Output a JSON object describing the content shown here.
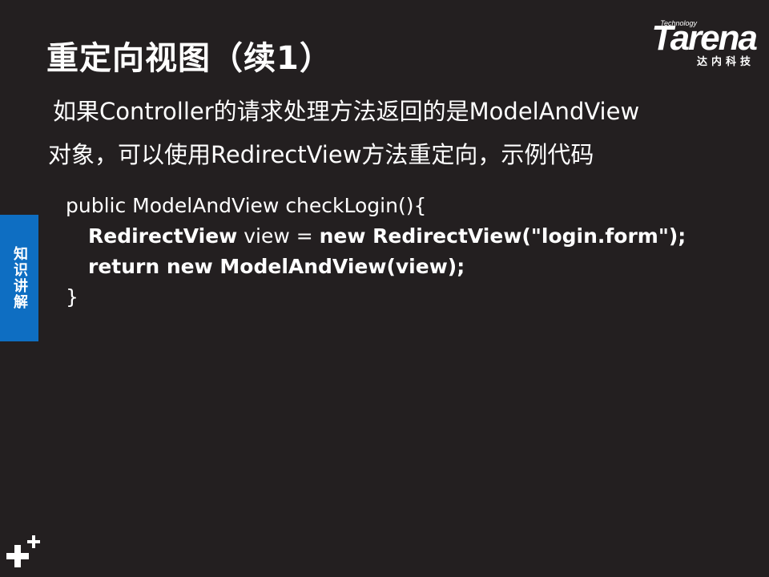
{
  "slide": {
    "title": "重定向视图（续1）",
    "intro_line1": "如果Controller的请求处理方法返回的是ModelAndView",
    "intro_line2": "对象，可以使用RedirectView方法重定向，示例代码"
  },
  "code": {
    "line1": "public ModelAndView checkLogin(){",
    "line2_class": "RedirectView",
    "line2_var": " view = ",
    "line2_new": "new RedirectView(\"login.form\");",
    "line3": "return new ModelAndView(view);",
    "line4": "}"
  },
  "logo": {
    "tech": "Technology",
    "word": "Tarena",
    "cn": "达内科技"
  },
  "side_tab": {
    "label": "知识讲解",
    "color": "#0e6ec2"
  },
  "icons": [
    "plus-icon"
  ]
}
